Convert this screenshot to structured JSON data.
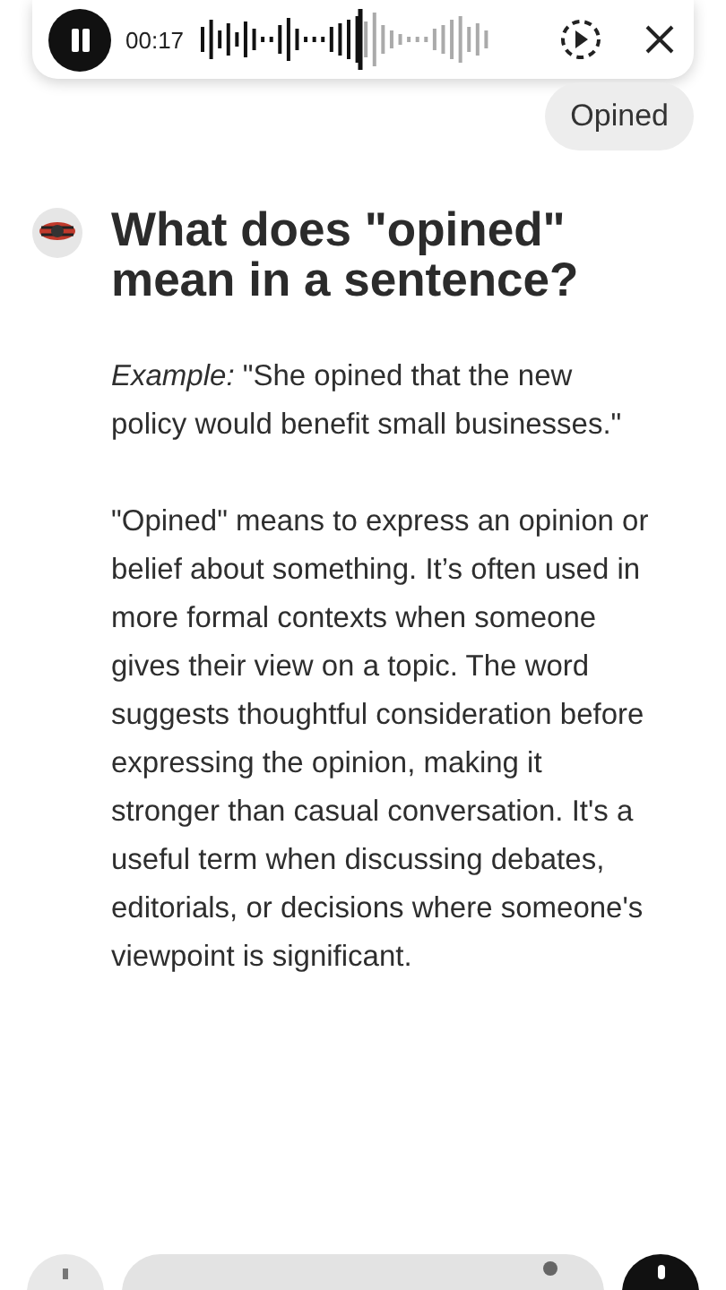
{
  "player": {
    "time": "00:17",
    "level": 0.55
  },
  "user_message": "Opined",
  "answer": {
    "title": "What does \"opined\" mean in a sentence?",
    "paragraphs": [
      "*Example:* \"She opined that the new policy would benefit small businesses.\"",
      "\"Opined\" means to express an opinion or belief about something. It’s often used in more formal contexts when someone gives their view on a topic. The word suggests thoughtful consideration before expressing the opinion, making it stronger than casual conversation. It's a useful term when discussing debates, editorials, or decisions where someone's viewpoint is significant."
    ]
  }
}
